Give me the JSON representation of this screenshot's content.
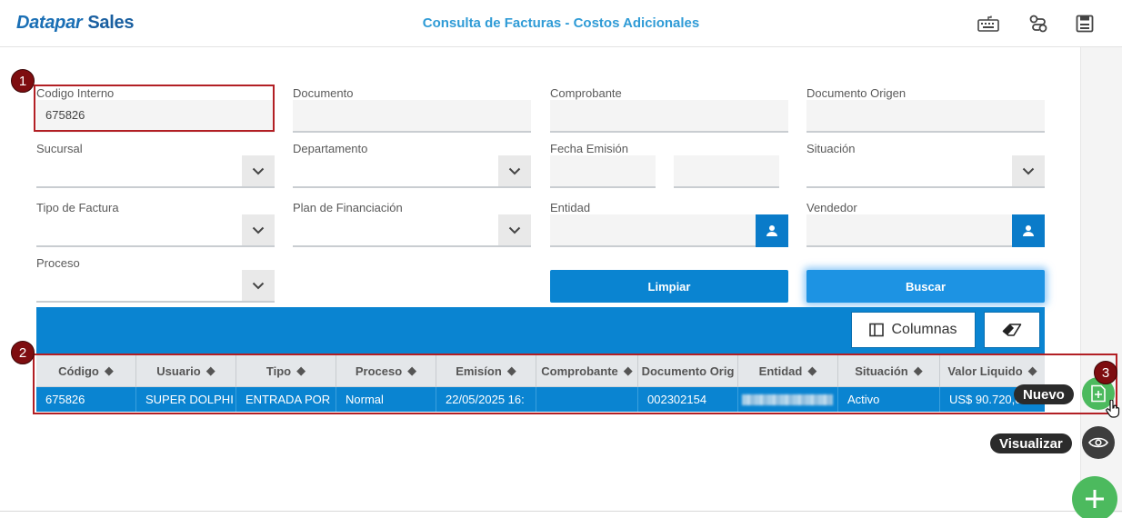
{
  "header": {
    "logo_brand": "Datapar",
    "logo_product": "Sales",
    "title": "Consulta de Facturas - Costos Adicionales"
  },
  "form": {
    "codigo_interno": {
      "label": "Codigo Interno",
      "value": "675826"
    },
    "documento": {
      "label": "Documento",
      "value": ""
    },
    "comprobante": {
      "label": "Comprobante",
      "value": ""
    },
    "documento_origen": {
      "label": "Documento Origen",
      "value": ""
    },
    "sucursal": {
      "label": "Sucursal",
      "value": ""
    },
    "departamento": {
      "label": "Departamento",
      "value": ""
    },
    "fecha_emision": {
      "label": "Fecha Emisión",
      "from": "",
      "to": ""
    },
    "situacion": {
      "label": "Situación",
      "value": ""
    },
    "tipo_factura": {
      "label": "Tipo de Factura",
      "value": ""
    },
    "plan_financiacion": {
      "label": "Plan de Financiación",
      "value": ""
    },
    "entidad": {
      "label": "Entidad",
      "value": ""
    },
    "vendedor": {
      "label": "Vendedor",
      "value": ""
    },
    "proceso": {
      "label": "Proceso",
      "value": ""
    }
  },
  "buttons": {
    "limpiar": "Limpiar",
    "buscar": "Buscar",
    "columnas": "Columnas"
  },
  "table": {
    "columns": [
      "Código",
      "Usuario",
      "Tipo",
      "Proceso",
      "Emisíon",
      "Comprobante",
      "Documento Orig",
      "Entidad",
      "Situación",
      "Valor Liquido"
    ],
    "rows": [
      [
        "675826",
        "SUPER DOLPHI",
        "ENTRADA POR",
        "Normal",
        "22/05/2025 16:",
        "",
        "002302154",
        "",
        "Activo",
        "US$ 90.720,00"
      ]
    ]
  },
  "fab": {
    "nuevo_tooltip": "Nuevo",
    "visualizar_tooltip": "Visualizar"
  },
  "annotations": [
    "1",
    "2",
    "3"
  ],
  "colors": {
    "primary": "#0a84d1",
    "accent_title": "#2f9bd6",
    "fab_green": "#4cba5e",
    "annotation_red": "#b21f24"
  }
}
